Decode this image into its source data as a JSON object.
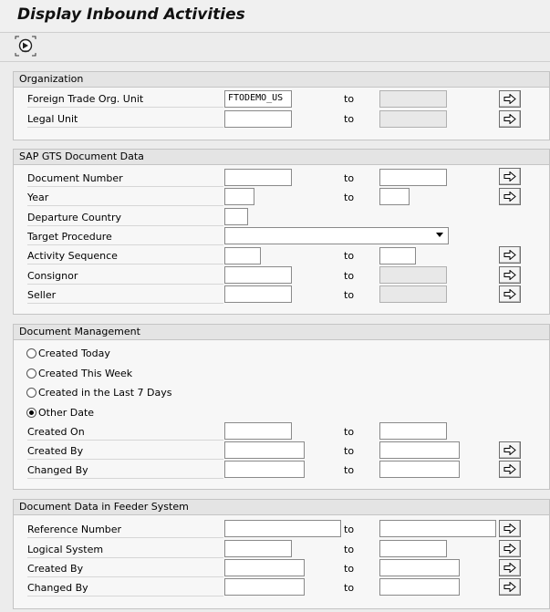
{
  "title": "Display Inbound Activities",
  "toolbar": {
    "execute_icon": "execute-icon"
  },
  "common": {
    "to": "to",
    "multi_icon": "multiple-selection-arrow-icon"
  },
  "organization": {
    "header": "Organization",
    "rows": [
      {
        "label": "Foreign Trade Org. Unit",
        "value": "FTODEMO_US"
      },
      {
        "label": "Legal Unit",
        "value": ""
      }
    ]
  },
  "sap_gts": {
    "header": "SAP GTS Document Data",
    "rows": [
      {
        "label": "Document Number"
      },
      {
        "label": "Year"
      },
      {
        "label": "Departure Country"
      },
      {
        "label": "Target Procedure",
        "value": ""
      },
      {
        "label": "Activity Sequence"
      },
      {
        "label": "Consignor"
      },
      {
        "label": "Seller"
      }
    ]
  },
  "doc_mgmt": {
    "header": "Document Management",
    "radios": [
      {
        "label": "Created Today",
        "selected": false
      },
      {
        "label": "Created This Week",
        "selected": false
      },
      {
        "label": "Created in the Last 7 Days",
        "selected": false
      },
      {
        "label": "Other Date",
        "selected": true
      }
    ],
    "rows": [
      {
        "label": "Created On"
      },
      {
        "label": "Created By"
      },
      {
        "label": "Changed By"
      }
    ]
  },
  "feeder": {
    "header": "Document Data in Feeder System",
    "rows": [
      {
        "label": "Reference Number"
      },
      {
        "label": "Logical System"
      },
      {
        "label": "Created By"
      },
      {
        "label": "Changed By"
      }
    ]
  }
}
